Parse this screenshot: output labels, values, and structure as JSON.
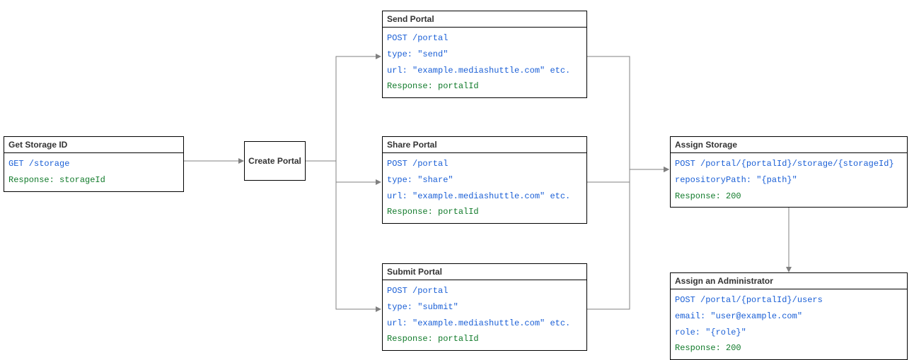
{
  "nodes": {
    "getStorage": {
      "title": "Get Storage ID",
      "lines": [
        {
          "text": "GET /storage",
          "cls": "req"
        },
        {
          "text": "Response: storageId",
          "cls": "res"
        }
      ]
    },
    "createPortal": {
      "title": "Create Portal"
    },
    "sendPortal": {
      "title": "Send Portal",
      "lines": [
        {
          "text": "POST /portal",
          "cls": "req"
        },
        {
          "text": "type: \"send\"",
          "cls": "req"
        },
        {
          "text": "url: \"example.mediashuttle.com\" etc.",
          "cls": "req"
        },
        {
          "text": "Response: portalId",
          "cls": "res"
        }
      ]
    },
    "sharePortal": {
      "title": "Share Portal",
      "lines": [
        {
          "text": "POST /portal",
          "cls": "req"
        },
        {
          "text": "type: \"share\"",
          "cls": "req"
        },
        {
          "text": "url: \"example.mediashuttle.com\" etc.",
          "cls": "req"
        },
        {
          "text": "Response: portalId",
          "cls": "res"
        }
      ]
    },
    "submitPortal": {
      "title": "Submit Portal",
      "lines": [
        {
          "text": "POST /portal",
          "cls": "req"
        },
        {
          "text": "type: \"submit\"",
          "cls": "req"
        },
        {
          "text": "url: \"example.mediashuttle.com\" etc.",
          "cls": "req"
        },
        {
          "text": "Response: portalId",
          "cls": "res"
        }
      ]
    },
    "assignStorage": {
      "title": "Assign Storage",
      "lines": [
        {
          "text": "POST /portal/{portalId}/storage/{storageId}",
          "cls": "req"
        },
        {
          "text": "repositoryPath: \"{path}\"",
          "cls": "req"
        },
        {
          "text": "Response: 200",
          "cls": "res"
        }
      ]
    },
    "assignAdmin": {
      "title": "Assign an Administrator",
      "lines": [
        {
          "text": "POST /portal/{portalId}/users",
          "cls": "req"
        },
        {
          "text": "email: \"user@example.com\"",
          "cls": "req"
        },
        {
          "text": "role: \"{role}\"",
          "cls": "req"
        },
        {
          "text": "Response: 200",
          "cls": "res"
        }
      ]
    }
  }
}
